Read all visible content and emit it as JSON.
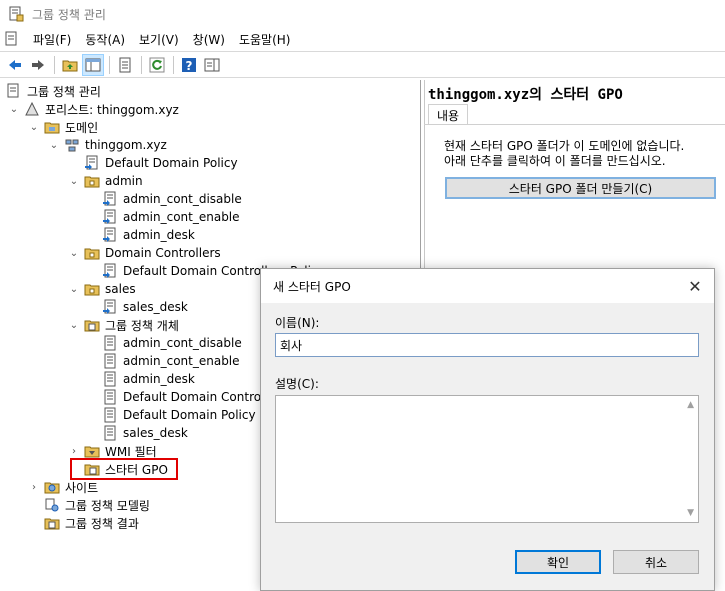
{
  "window": {
    "title": "그룹 정책 관리"
  },
  "menu": [
    "파일(F)",
    "동작(A)",
    "보기(V)",
    "창(W)",
    "도움말(H)"
  ],
  "toolbar": {
    "icons": [
      "back-arrow-icon",
      "forward-arrow-icon",
      "up-folder-icon",
      "show-hide-tree-icon",
      "properties-icon",
      "refresh-icon",
      "help-icon",
      "action-pane-icon"
    ]
  },
  "tree": {
    "root": "그룹 정책 관리",
    "forest": "포리스트: thinggom.xyz",
    "domains": "도메인",
    "domain": "thinggom.xyz",
    "default_domain_policy": "Default Domain Policy",
    "admin_ou": "admin",
    "admin_children": [
      "admin_cont_disable",
      "admin_cont_enable",
      "admin_desk"
    ],
    "dc_ou": "Domain Controllers",
    "dc_child": "Default Domain Controllers Policy",
    "sales_ou": "sales",
    "sales_child": "sales_desk",
    "gpo_container": "그룹 정책 개체",
    "gpo_children": [
      "admin_cont_disable",
      "admin_cont_enable",
      "admin_desk",
      "Default Domain Controllers Policy",
      "Default Domain Policy",
      "sales_desk"
    ],
    "wmi": "WMI 필터",
    "starter": "스타터 GPO",
    "sites": "사이트",
    "modeling": "그룹 정책 모델링",
    "results": "그룹 정책 결과"
  },
  "right_pane": {
    "title": "thinggom.xyz의 스타터 GPO",
    "tab": "내용",
    "message_line1": "현재 스타터 GPO 폴더가 이 도메인에 없습니다.",
    "message_line2": "아래 단추를 클릭하여 이 폴더를 만드십시오.",
    "create_button": "스타터 GPO 폴더 만들기(C)"
  },
  "dialog": {
    "title": "새 스타터 GPO",
    "name_label": "이름(N):",
    "name_value": "회사",
    "comment_label": "설명(C):",
    "comment_value": "",
    "ok": "확인",
    "cancel": "취소"
  },
  "colors": {
    "highlight": "#e00000",
    "accent": "#0078d7",
    "folder": "#e8c15a"
  }
}
